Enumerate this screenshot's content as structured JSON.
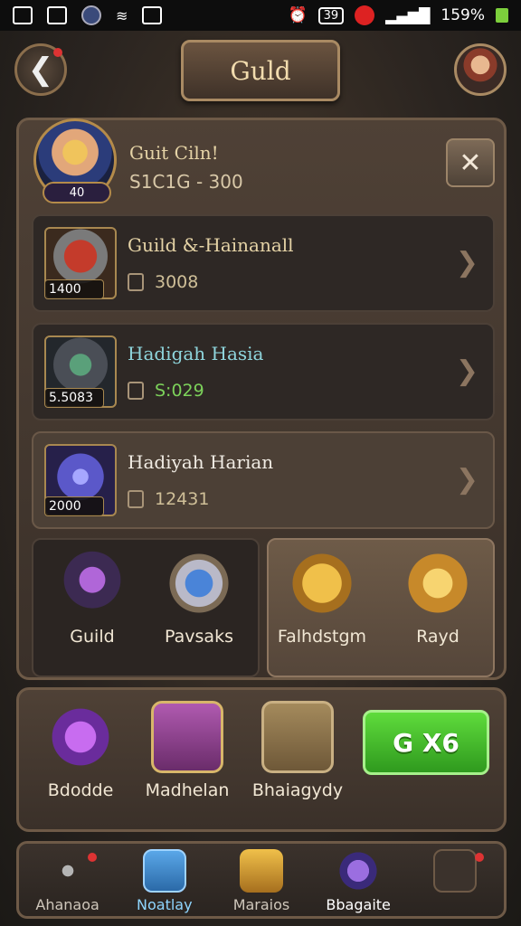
{
  "status_bar": {
    "battery_text": "39",
    "battery_percent": "159%"
  },
  "header": {
    "back_icon": "chevron-left-icon",
    "title": "Guld"
  },
  "guild": {
    "name": "Guit Ciln!",
    "stat": "S1C1G - 300",
    "emblem_badge": "40",
    "close_icon": "close-icon"
  },
  "members": [
    {
      "name": "Guild &-Hainanall",
      "level": "1400",
      "power": "3008"
    },
    {
      "name": "Hadigah Hasia",
      "level": "5.5083",
      "power": "S:029"
    },
    {
      "name": "Hadiyah Harian",
      "level": "2000",
      "power": "12431"
    }
  ],
  "features_left": [
    {
      "label": "Guild",
      "icon": "mage-icon"
    },
    {
      "label": "Pavsaks",
      "icon": "shield-icon"
    }
  ],
  "features_right": [
    {
      "label": "Falhdstgm",
      "icon": "gold-crest-icon"
    },
    {
      "label": "Rayd",
      "icon": "gold-chest-icon"
    }
  ],
  "rewards": [
    {
      "label": "Bdodde",
      "icon": "gem-icon"
    },
    {
      "label": "Madhelan",
      "icon": "book-icon"
    },
    {
      "label": "Bhaiagydy",
      "icon": "crate-icon"
    }
  ],
  "action_button": {
    "label": "G X6"
  },
  "bottom_nav": [
    {
      "label": "Ahanaoa",
      "color": "#cfc7bb",
      "icon": "swords-icon"
    },
    {
      "label": "Noatlay",
      "color": "#8fd6ff",
      "icon": "card-icon"
    },
    {
      "label": "Maraios",
      "color": "#cfc7bb",
      "icon": "chest-icon"
    },
    {
      "label": "Bbagaite",
      "color": "#ffffff",
      "icon": "orb-icon"
    },
    {
      "label": "",
      "color": "#cfc7bb",
      "icon": "friend-icon"
    }
  ]
}
